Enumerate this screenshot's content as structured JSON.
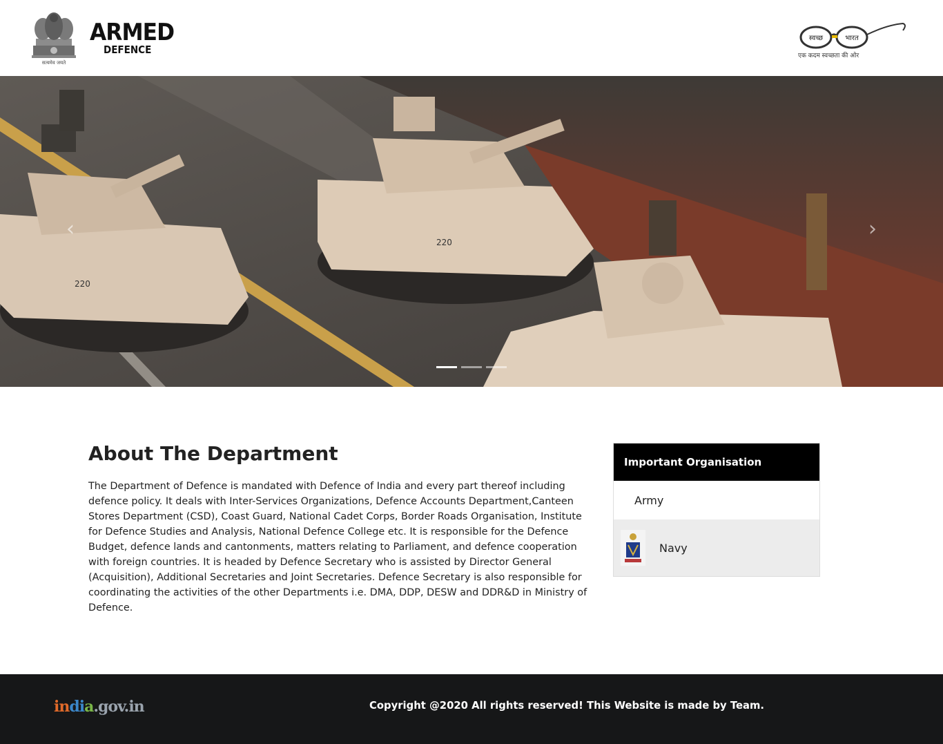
{
  "header": {
    "brand_title": "ARMED",
    "brand_subtitle": "DEFENCE",
    "emblem_caption": "सत्यमेव जयते",
    "swachh_left": "स्वच्छ",
    "swachh_right": "भारत",
    "swachh_tagline": "एक कदम स्वच्छता की ओर"
  },
  "carousel": {
    "prev_icon": "chevron-left-icon",
    "next_icon": "chevron-right-icon",
    "prev_glyph": "‹",
    "next_glyph": "›",
    "slide_count": 3,
    "active_index": 0,
    "tank_number": "220"
  },
  "about": {
    "title": "About The Department",
    "text": "The Department of Defence is mandated with Defence of India and every part thereof including defence policy. It deals with Inter-Services Organizations, Defence Accounts Department,Canteen Stores Department (CSD), Coast Guard, National Cadet Corps, Border Roads Organisation, Institute for Defence Studies and Analysis, National Defence College etc. It is responsible for the Defence Budget, defence lands and cantonments, matters relating to Parliament, and defence cooperation with foreign countries. It is headed by Defence Secretary who is assisted by Director General (Acquisition), Additional Secretaries and Joint Secretaries. Defence Secretary is also responsible for coordinating the activities of the other Departments i.e. DMA, DDP, DESW and DDR&D in Ministry of Defence."
  },
  "organisation": {
    "title": "Important Organisation",
    "items": [
      {
        "label": "Army"
      },
      {
        "label": "Navy"
      }
    ]
  },
  "footer": {
    "logo_part1": "in",
    "logo_part2": "di",
    "logo_part3": "a",
    "logo_part4": ".gov.in",
    "copyright": "Copyright @2020 All rights reserved! This Website is made by Team."
  },
  "colors": {
    "footer_bg": "#161718",
    "panel_header_bg": "#000000",
    "navy_item_bg": "#ececec"
  }
}
